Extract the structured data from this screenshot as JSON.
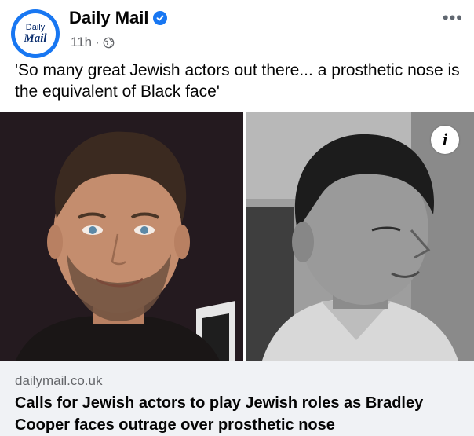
{
  "post": {
    "page_name": "Daily Mail",
    "logo_top": "Daily",
    "logo_bottom": "Mail",
    "time": "11h",
    "separator": "·",
    "more_label": "•••",
    "text": "'So many great Jewish actors out there... a prosthetic nose is the equivalent of Black face'",
    "info_label": "i"
  },
  "link": {
    "domain": "dailymail.co.uk",
    "headline": "Calls for Jewish actors to play Jewish roles as Bradley Cooper faces outrage over prosthetic nose"
  },
  "colors": {
    "brand_blue": "#1877f2",
    "card_bg": "#f0f2f5",
    "meta_gray": "#65676b"
  },
  "icons": [
    "verified-badge-icon",
    "globe-icon",
    "more-options-icon",
    "info-icon"
  ]
}
